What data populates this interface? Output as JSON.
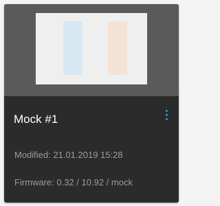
{
  "card": {
    "title": "Mock #1",
    "modified": "Modified: 21.01.2019 15:28",
    "firmware": "Firmware: 0.32 / 10.92 / mock",
    "menu_icon": "more-vert-icon"
  },
  "colors": {
    "card_background": "#2b2b2b",
    "preview_background": "#5a5a5a",
    "preview_frame": "#efefef",
    "bar_blue": "#d7e8f2",
    "bar_orange": "#f4e2d4",
    "accent": "#1da1e3",
    "title_text": "#ffffff",
    "meta_text": "#9c9c9c"
  }
}
